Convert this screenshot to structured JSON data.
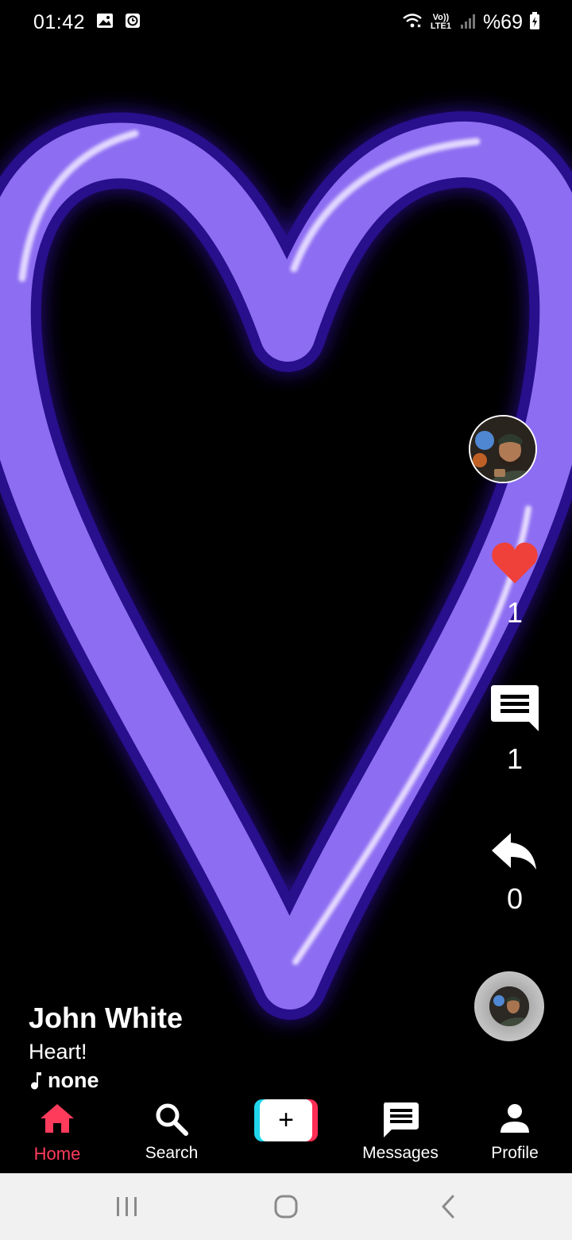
{
  "status_bar": {
    "time": "01:42",
    "battery_percent": "%69",
    "network_label": "Vo)) LTE1",
    "icons": [
      "image-icon",
      "clock-icon",
      "wifi-icon",
      "signal-icon",
      "battery-icon"
    ]
  },
  "video": {
    "description_colors": {
      "heart": "#8b6cf0",
      "glow": "#5b2bff"
    }
  },
  "actions": {
    "likes": "1",
    "comments": "1",
    "shares": "0",
    "like_color": "#f0403a"
  },
  "caption": {
    "username": "John White",
    "text": "Heart!",
    "music": "none"
  },
  "bottom_nav": {
    "items": [
      {
        "label": "Home",
        "icon": "home-icon",
        "active": true
      },
      {
        "label": "Search",
        "icon": "search-icon",
        "active": false
      },
      {
        "label": "",
        "icon": "plus-icon",
        "active": false
      },
      {
        "label": "Messages",
        "icon": "messages-icon",
        "active": false
      },
      {
        "label": "Profile",
        "icon": "profile-icon",
        "active": false
      }
    ],
    "active_color": "#ff3b5c"
  },
  "system_nav": {
    "buttons": [
      "recents-icon",
      "home-circle-icon",
      "back-icon"
    ]
  }
}
